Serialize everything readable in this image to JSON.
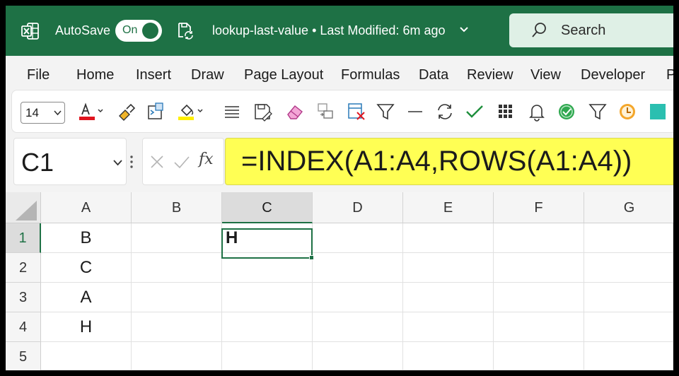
{
  "titlebar": {
    "autosave_label": "AutoSave",
    "autosave_state": "On",
    "document_title": "lookup-last-value • Last Modified: 6m ago",
    "search_label": "Search",
    "brand_color": "#1e7145"
  },
  "menu": {
    "items": [
      "File",
      "Home",
      "Insert",
      "Draw",
      "Page Layout",
      "Formulas",
      "Data",
      "Review",
      "View",
      "Developer",
      "P"
    ]
  },
  "toolbar": {
    "font_size": "14",
    "icons": [
      "font-color-icon",
      "format-painter-icon",
      "paste-special-icon",
      "fill-color-icon",
      "align-icon",
      "save-edit-icon",
      "eraser-icon",
      "move-icon",
      "delete-filter-icon",
      "filter-icon",
      "line-icon",
      "refresh-icon",
      "check-icon",
      "grid-icon",
      "bell-icon",
      "check-circle-icon",
      "funnel-icon",
      "clock-icon",
      "teal-square-icon"
    ]
  },
  "formula_bar": {
    "name_box": "C1",
    "fx_label": "fx",
    "formula": "=INDEX(A1:A4,ROWS(A1:A4))",
    "highlight_color": "#ffff54"
  },
  "sheet": {
    "columns": [
      "A",
      "B",
      "C",
      "D",
      "E",
      "F",
      "G"
    ],
    "rows": [
      "1",
      "2",
      "3",
      "4",
      "5"
    ],
    "selected_cell": "C1",
    "cells": {
      "A1": "B",
      "A2": "C",
      "A3": "A",
      "A4": "H",
      "C1": "H"
    }
  }
}
